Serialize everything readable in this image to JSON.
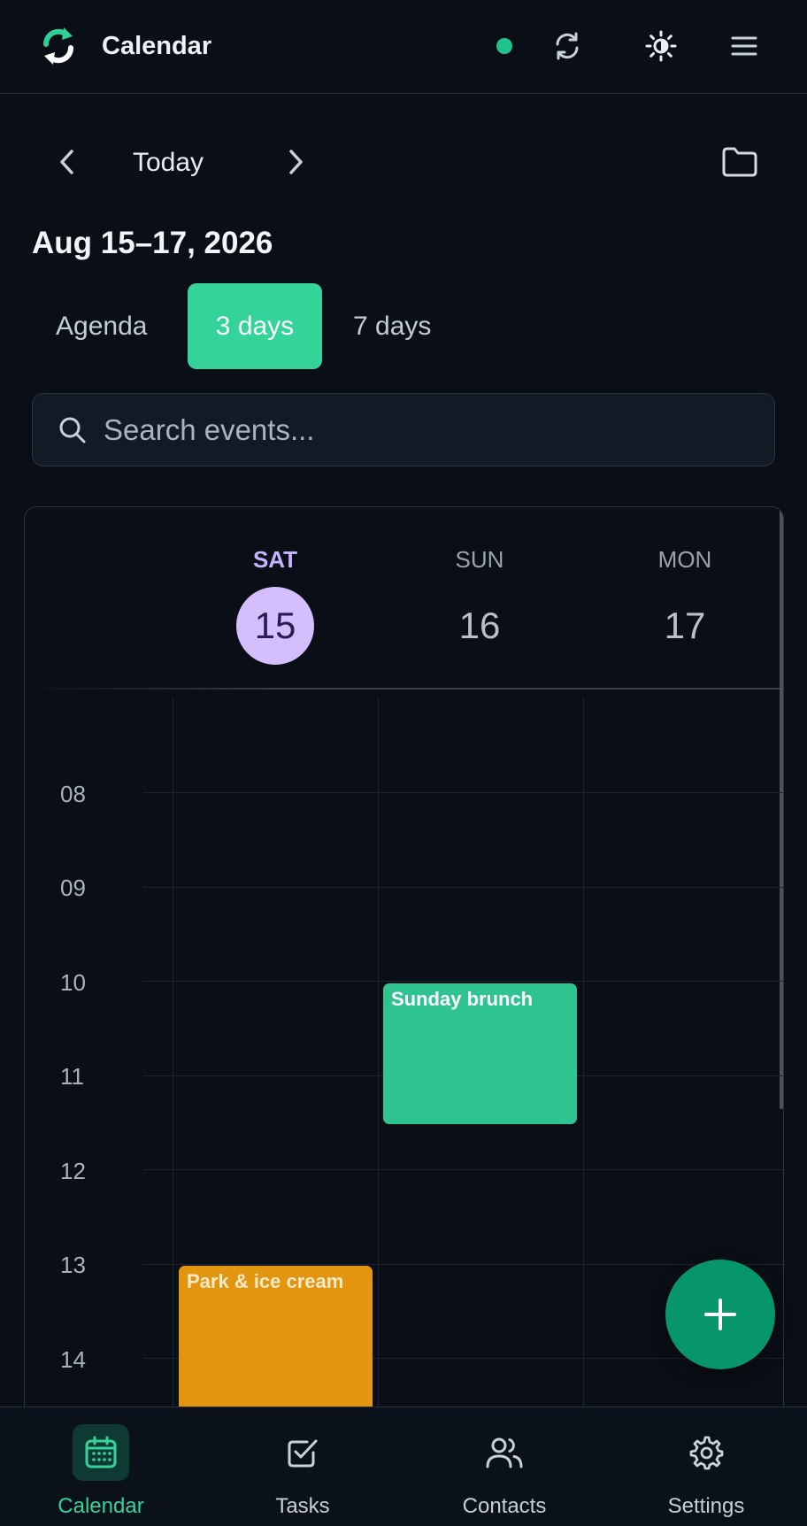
{
  "app": {
    "title": "Calendar"
  },
  "header": {
    "status_color": "#1fc48a",
    "icons": [
      "sync-logo-icon",
      "refresh-icon",
      "theme-toggle-icon",
      "menu-icon"
    ]
  },
  "navigation": {
    "today_label": "Today",
    "range_title": "Aug 15–17, 2026"
  },
  "view_tabs": {
    "agenda": "Agenda",
    "three_days": "3 days",
    "seven_days": "7 days",
    "active": "3 days"
  },
  "search": {
    "placeholder": "Search events..."
  },
  "days": [
    {
      "name": "SAT",
      "number": "15",
      "selected": true
    },
    {
      "name": "SUN",
      "number": "16",
      "selected": false
    },
    {
      "name": "MON",
      "number": "17",
      "selected": false
    }
  ],
  "hours": [
    "08",
    "09",
    "10",
    "11",
    "12",
    "13",
    "14"
  ],
  "events": [
    {
      "title": "Sunday brunch",
      "day": "SUN",
      "start": "10",
      "color": "#2fc48f"
    },
    {
      "title": "Park & ice cream",
      "day": "SAT",
      "start": "13",
      "color": "#e2950f"
    }
  ],
  "bottom_nav": [
    {
      "label": "Calendar",
      "icon": "calendar-icon",
      "active": true
    },
    {
      "label": "Tasks",
      "icon": "checkbox-icon",
      "active": false
    },
    {
      "label": "Contacts",
      "icon": "users-icon",
      "active": false
    },
    {
      "label": "Settings",
      "icon": "gear-icon",
      "active": false
    }
  ],
  "colors": {
    "accent": "#34d399",
    "fab": "#069669",
    "today_circle": "#d4bffc"
  }
}
